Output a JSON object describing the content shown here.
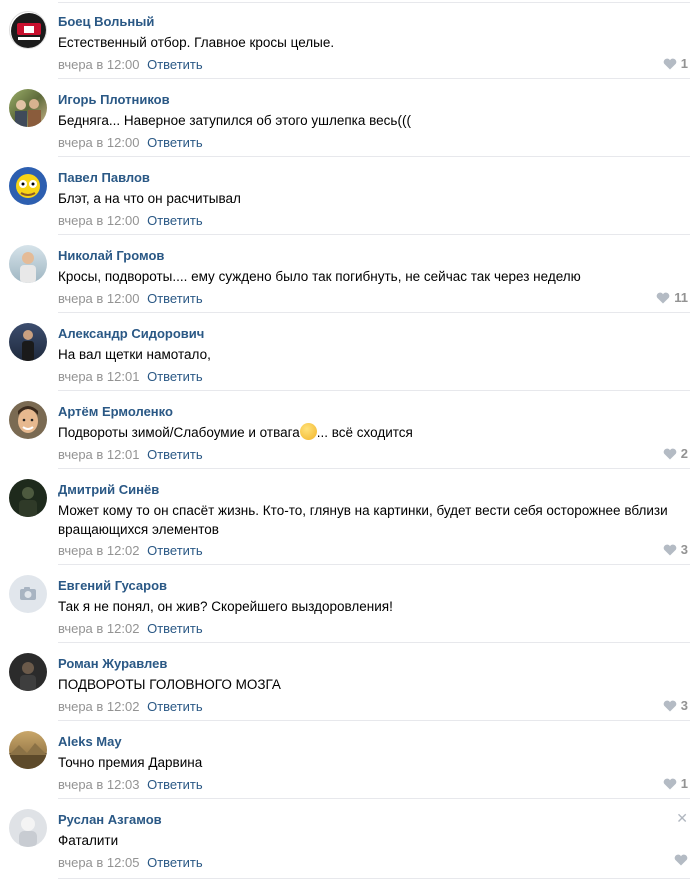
{
  "comments": [
    {
      "author": "Боец Вольный",
      "text": "Естественный отбор. Главное кросы целые.",
      "time": "вчера в 12:00",
      "reply": "Ответить",
      "likes": "1",
      "avatar": "fist-logo-avatar"
    },
    {
      "author": "Игорь Плотников",
      "text": "Бедняга... Наверное затупился об этого ушлепка весь(((",
      "time": "вчера в 12:00",
      "reply": "Ответить",
      "likes": "",
      "avatar": "group-photo-avatar"
    },
    {
      "author": "Павел Павлов",
      "text": "Блэт, а на что он расчитывал",
      "time": "вчера в 12:00",
      "reply": "Ответить",
      "likes": "",
      "avatar": "cartoon-avatar"
    },
    {
      "author": "Николай Громов",
      "text": "Кросы, подвороты.... ему суждено было так погибнуть, не сейчас так через неделю",
      "time": "вчера в 12:00",
      "reply": "Ответить",
      "likes": "11",
      "avatar": "person-avatar"
    },
    {
      "author": "Александр Сидорович",
      "text": "На вал щетки намотало,",
      "time": "вчера в 12:01",
      "reply": "Ответить",
      "likes": "",
      "avatar": "person-avatar"
    },
    {
      "author": "Артём Ермоленко",
      "text": "Подвороты зимой/Слабоумие и отвага",
      "text_after_emoji": "... всё сходится",
      "time": "вчера в 12:01",
      "reply": "Ответить",
      "likes": "2",
      "avatar": "face-avatar"
    },
    {
      "author": "Дмитрий Синёв",
      "text": "Может кому то он спасёт жизнь. Кто-то, глянув на картинки, будет вести себя осторожнее вблизи вращающихся элементов",
      "time": "вчера в 12:02",
      "reply": "Ответить",
      "likes": "3",
      "avatar": "dark-avatar"
    },
    {
      "author": "Евгений Гусаров",
      "text": "Так я не понял, он жив? Скорейшего выздоровления!",
      "time": "вчера в 12:02",
      "reply": "Ответить",
      "likes": "",
      "avatar": "camera-placeholder-avatar"
    },
    {
      "author": "Роман Журавлев",
      "text": "ПОДВОРОТЫ ГОЛОВНОГО МОЗГА",
      "time": "вчера в 12:02",
      "reply": "Ответить",
      "likes": "3",
      "avatar": "dark-avatar"
    },
    {
      "author": "Aleks May",
      "text": "Точно премия Дарвина",
      "time": "вчера в 12:03",
      "reply": "Ответить",
      "likes": "1",
      "avatar": "landscape-avatar"
    },
    {
      "author": "Руслан Азгамов",
      "text": "Фаталити",
      "time": "вчера в 12:05",
      "reply": "Ответить",
      "likes": "",
      "avatar": "light-avatar",
      "show_close": true
    }
  ],
  "colors": {
    "name": "#2a5885",
    "meta": "#939393",
    "divider": "#e7e8ec"
  }
}
